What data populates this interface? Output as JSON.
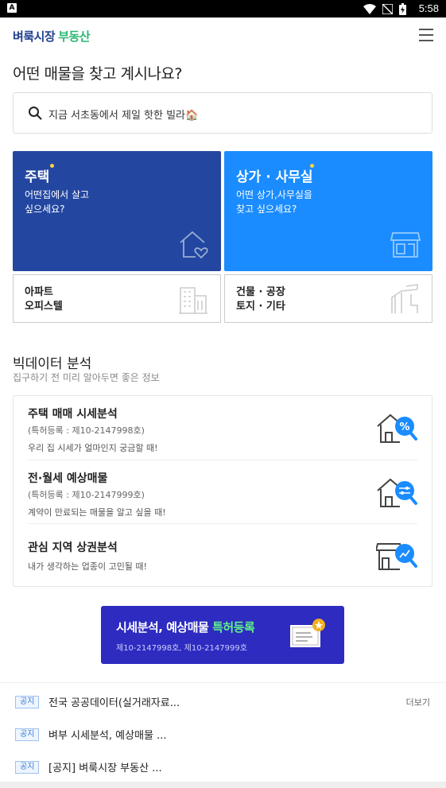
{
  "status_bar": {
    "time": "5:58",
    "app_icon": "A"
  },
  "header": {
    "logo_main": "벼룩시장",
    "logo_sub": "부동산",
    "menu_icon": "hamburger-icon"
  },
  "question": "어떤 매물을 찾고 계시나요?",
  "search": {
    "placeholder": "지금 서초동에서 제일 핫한 빌라🏠"
  },
  "categories": {
    "housing": {
      "title": "주택",
      "desc_line1": "어떤집에서 살고",
      "desc_line2": "싶으세요?"
    },
    "commercial": {
      "title": "상가 · 사무실",
      "desc_line1": "어떤 상가,사무실을",
      "desc_line2": "찾고 싶으세요?"
    },
    "apartment": {
      "line1": "아파트",
      "line2": "오피스텔"
    },
    "building": {
      "line1": "건물 · 공장",
      "line2": "토지 · 기타"
    }
  },
  "big_data": {
    "title": "빅데이터 분석",
    "subtitle": "집구하기 전 미리 알아두면 좋은 정보",
    "items": [
      {
        "title": "주택 매매 시세분석",
        "patent": "(특허등록 : 제10-2147998호)",
        "desc": "우리 집 시세가 얼마인지 궁금할 때!"
      },
      {
        "title": "전·월세 예상매물",
        "patent": "(특허등록 : 제10-2147999호)",
        "desc": "계약이 만료되는 매물을 알고 싶을 때!"
      },
      {
        "title": "관심 지역 상권분석",
        "desc": "내가 생각하는 업종이 고민될 때!"
      }
    ]
  },
  "banner": {
    "title_white": "시세분석, 예상매물",
    "title_green": "특허등록",
    "subtitle": "제10-2147998호, 제10-2147999호"
  },
  "notices": {
    "more_label": "더보기",
    "items": [
      {
        "tag": "공지",
        "text": "전국 공공데이터(실거래자료..."
      },
      {
        "tag": "공지",
        "text": "벼부 시세분석, 예상매물 ..."
      },
      {
        "tag": "공지",
        "text": "[공지] 벼룩시장 부동산 ..."
      }
    ]
  },
  "colors": {
    "housing_card": "#2347a0",
    "commercial_card": "#1a8cff",
    "banner": "#2d2bc0",
    "accent_green": "#2bb673"
  }
}
